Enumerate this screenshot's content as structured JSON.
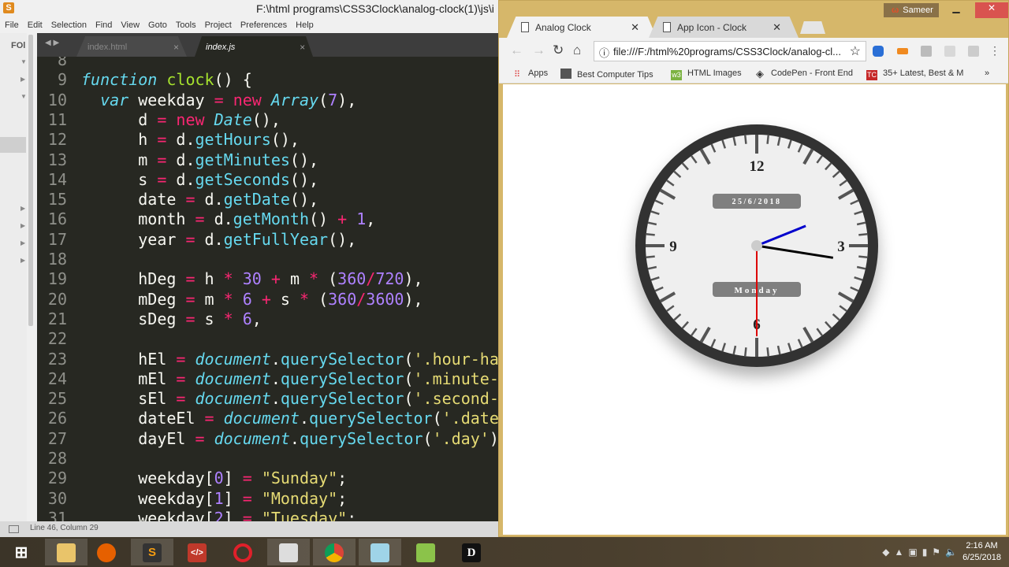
{
  "sublime": {
    "title": "F:\\html programs\\CSS3Clock\\analog-clock(1)\\js\\i",
    "menu": [
      "File",
      "Edit",
      "Selection",
      "Find",
      "View",
      "Goto",
      "Tools",
      "Project",
      "Preferences",
      "Help"
    ],
    "sidebar_label": "FOl",
    "tabs": [
      {
        "label": "index.html",
        "active": false
      },
      {
        "label": "index.js",
        "active": true
      }
    ],
    "status": "Line 46, Column 29",
    "code": [
      {
        "n": "8",
        "t": []
      },
      {
        "n": "9",
        "t": [
          [
            "sto",
            "function"
          ],
          [
            "txt",
            " "
          ],
          [
            "fn",
            "clock"
          ],
          [
            "txt",
            "() {"
          ]
        ]
      },
      {
        "n": "10",
        "t": [
          [
            "txt",
            "  "
          ],
          [
            "sto",
            "var"
          ],
          [
            "txt",
            " weekday "
          ],
          [
            "kw",
            "="
          ],
          [
            "txt",
            " "
          ],
          [
            "kw",
            "new"
          ],
          [
            "txt",
            " "
          ],
          [
            "it",
            "Array"
          ],
          [
            "txt",
            "("
          ],
          [
            "num",
            "7"
          ],
          [
            "txt",
            "),"
          ]
        ]
      },
      {
        "n": "11",
        "t": [
          [
            "txt",
            "      d "
          ],
          [
            "kw",
            "="
          ],
          [
            "txt",
            " "
          ],
          [
            "kw",
            "new"
          ],
          [
            "txt",
            " "
          ],
          [
            "it",
            "Date"
          ],
          [
            "txt",
            "(),"
          ]
        ]
      },
      {
        "n": "12",
        "t": [
          [
            "txt",
            "      h "
          ],
          [
            "kw",
            "="
          ],
          [
            "txt",
            " d."
          ],
          [
            "sup",
            "getHours"
          ],
          [
            "txt",
            "(),"
          ]
        ]
      },
      {
        "n": "13",
        "t": [
          [
            "txt",
            "      m "
          ],
          [
            "kw",
            "="
          ],
          [
            "txt",
            " d."
          ],
          [
            "sup",
            "getMinutes"
          ],
          [
            "txt",
            "(),"
          ]
        ]
      },
      {
        "n": "14",
        "t": [
          [
            "txt",
            "      s "
          ],
          [
            "kw",
            "="
          ],
          [
            "txt",
            " d."
          ],
          [
            "sup",
            "getSeconds"
          ],
          [
            "txt",
            "(),"
          ]
        ]
      },
      {
        "n": "15",
        "t": [
          [
            "txt",
            "      date "
          ],
          [
            "kw",
            "="
          ],
          [
            "txt",
            " d."
          ],
          [
            "sup",
            "getDate"
          ],
          [
            "txt",
            "(),"
          ]
        ]
      },
      {
        "n": "16",
        "t": [
          [
            "txt",
            "      month "
          ],
          [
            "kw",
            "="
          ],
          [
            "txt",
            " d."
          ],
          [
            "sup",
            "getMonth"
          ],
          [
            "txt",
            "() "
          ],
          [
            "kw",
            "+"
          ],
          [
            "txt",
            " "
          ],
          [
            "num",
            "1"
          ],
          [
            "txt",
            ","
          ]
        ]
      },
      {
        "n": "17",
        "t": [
          [
            "txt",
            "      year "
          ],
          [
            "kw",
            "="
          ],
          [
            "txt",
            " d."
          ],
          [
            "sup",
            "getFullYear"
          ],
          [
            "txt",
            "(),"
          ]
        ]
      },
      {
        "n": "18",
        "t": []
      },
      {
        "n": "19",
        "t": [
          [
            "txt",
            "      hDeg "
          ],
          [
            "kw",
            "="
          ],
          [
            "txt",
            " h "
          ],
          [
            "kw",
            "*"
          ],
          [
            "txt",
            " "
          ],
          [
            "num",
            "30"
          ],
          [
            "txt",
            " "
          ],
          [
            "kw",
            "+"
          ],
          [
            "txt",
            " m "
          ],
          [
            "kw",
            "*"
          ],
          [
            "txt",
            " ("
          ],
          [
            "num",
            "360"
          ],
          [
            "kw",
            "/"
          ],
          [
            "num",
            "720"
          ],
          [
            "txt",
            "),"
          ]
        ]
      },
      {
        "n": "20",
        "t": [
          [
            "txt",
            "      mDeg "
          ],
          [
            "kw",
            "="
          ],
          [
            "txt",
            " m "
          ],
          [
            "kw",
            "*"
          ],
          [
            "txt",
            " "
          ],
          [
            "num",
            "6"
          ],
          [
            "txt",
            " "
          ],
          [
            "kw",
            "+"
          ],
          [
            "txt",
            " s "
          ],
          [
            "kw",
            "*"
          ],
          [
            "txt",
            " ("
          ],
          [
            "num",
            "360"
          ],
          [
            "kw",
            "/"
          ],
          [
            "num",
            "3600"
          ],
          [
            "txt",
            "),"
          ]
        ]
      },
      {
        "n": "21",
        "t": [
          [
            "txt",
            "      sDeg "
          ],
          [
            "kw",
            "="
          ],
          [
            "txt",
            " s "
          ],
          [
            "kw",
            "*"
          ],
          [
            "txt",
            " "
          ],
          [
            "num",
            "6"
          ],
          [
            "txt",
            ","
          ]
        ]
      },
      {
        "n": "22",
        "t": []
      },
      {
        "n": "23",
        "t": [
          [
            "txt",
            "      hEl "
          ],
          [
            "kw",
            "="
          ],
          [
            "txt",
            " "
          ],
          [
            "it",
            "document"
          ],
          [
            "txt",
            "."
          ],
          [
            "sup",
            "querySelector"
          ],
          [
            "txt",
            "("
          ],
          [
            "str",
            "'.hour-har"
          ]
        ]
      },
      {
        "n": "24",
        "t": [
          [
            "txt",
            "      mEl "
          ],
          [
            "kw",
            "="
          ],
          [
            "txt",
            " "
          ],
          [
            "it",
            "document"
          ],
          [
            "txt",
            "."
          ],
          [
            "sup",
            "querySelector"
          ],
          [
            "txt",
            "("
          ],
          [
            "str",
            "'.minute-h"
          ]
        ]
      },
      {
        "n": "25",
        "t": [
          [
            "txt",
            "      sEl "
          ],
          [
            "kw",
            "="
          ],
          [
            "txt",
            " "
          ],
          [
            "it",
            "document"
          ],
          [
            "txt",
            "."
          ],
          [
            "sup",
            "querySelector"
          ],
          [
            "txt",
            "("
          ],
          [
            "str",
            "'.second-h"
          ]
        ]
      },
      {
        "n": "26",
        "t": [
          [
            "txt",
            "      dateEl "
          ],
          [
            "kw",
            "="
          ],
          [
            "txt",
            " "
          ],
          [
            "it",
            "document"
          ],
          [
            "txt",
            "."
          ],
          [
            "sup",
            "querySelector"
          ],
          [
            "txt",
            "("
          ],
          [
            "str",
            "'.date'"
          ]
        ]
      },
      {
        "n": "27",
        "t": [
          [
            "txt",
            "      dayEl "
          ],
          [
            "kw",
            "="
          ],
          [
            "txt",
            " "
          ],
          [
            "it",
            "document"
          ],
          [
            "txt",
            "."
          ],
          [
            "sup",
            "querySelector"
          ],
          [
            "txt",
            "("
          ],
          [
            "str",
            "'.day'"
          ],
          [
            "txt",
            ");"
          ]
        ]
      },
      {
        "n": "28",
        "t": []
      },
      {
        "n": "29",
        "t": [
          [
            "txt",
            "      weekday["
          ],
          [
            "num",
            "0"
          ],
          [
            "txt",
            "] "
          ],
          [
            "kw",
            "="
          ],
          [
            "txt",
            " "
          ],
          [
            "str",
            "\"Sunday\""
          ],
          [
            "txt",
            ";"
          ]
        ]
      },
      {
        "n": "30",
        "t": [
          [
            "txt",
            "      weekday["
          ],
          [
            "num",
            "1"
          ],
          [
            "txt",
            "] "
          ],
          [
            "kw",
            "="
          ],
          [
            "txt",
            " "
          ],
          [
            "str",
            "\"Monday\""
          ],
          [
            "txt",
            ";"
          ]
        ]
      },
      {
        "n": "31",
        "t": [
          [
            "txt",
            "      weekday["
          ],
          [
            "num",
            "2"
          ],
          [
            "txt",
            "] "
          ],
          [
            "kw",
            "="
          ],
          [
            "txt",
            " "
          ],
          [
            "str",
            "\"Tuesday\""
          ],
          [
            "txt",
            ";"
          ]
        ]
      }
    ]
  },
  "chrome": {
    "user": "Sameer",
    "tabs": [
      {
        "label": "Analog Clock",
        "active": true
      },
      {
        "label": "App Icon - Clock",
        "active": false
      }
    ],
    "url": "file:///F:/html%20programs/CSS3Clock/analog-cl...",
    "bookmarks": [
      "Apps",
      "Best Computer Tips",
      "HTML Images",
      "CodePen - Front End",
      "35+ Latest, Best & M"
    ],
    "more": "»"
  },
  "clock": {
    "numerals": [
      "12",
      "3",
      "6",
      "9"
    ],
    "date": "25/6/2018",
    "day": "Monday",
    "time": {
      "hours": 2,
      "minutes": 16,
      "seconds": 30
    },
    "colors": {
      "hour_hand": "#0000cc",
      "minute_hand": "#000000",
      "second_hand": "#dd0000",
      "frame": "#333333",
      "face": "#efefef",
      "label_bg": "#7f7f7f"
    }
  },
  "taskbar": {
    "apps": [
      "windows-start",
      "file-explorer",
      "firefox",
      "sublime-text",
      "code-editor",
      "opera",
      "app",
      "chrome",
      "notepad",
      "bluestacks",
      "d-app"
    ],
    "time": "2:16 AM",
    "date": "6/25/2018"
  }
}
